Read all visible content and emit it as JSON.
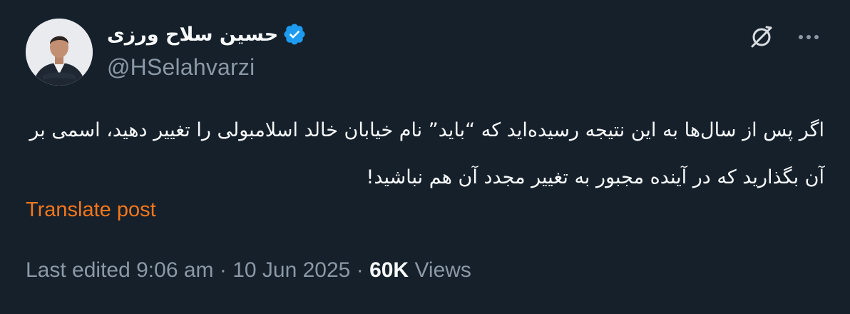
{
  "author": {
    "display_name": "حسین سلاح ورزی",
    "handle": "@HSelahvarzi",
    "verified": true
  },
  "icons": {
    "verified": "verified-badge-icon",
    "grok": "grok-icon",
    "more": "more-options-icon"
  },
  "tweet": {
    "text": "اگر پس از سال‌ها به این نتیجه رسیده‌اید که “باید” نام خیابان خالد اسلامبولی را تغییر دهید، اسمی بر آن بگذارید که در آینده مجبور به تغییر مجدد آن هم نباشید!",
    "translate_label": "Translate post"
  },
  "meta": {
    "edited_label": "Last edited",
    "time": "9:06 am",
    "separator": "·",
    "date": "10 Jun 2025",
    "views_count": "60K",
    "views_label": "Views"
  },
  "colors": {
    "background": "#15202b",
    "text_primary": "#f7f9f9",
    "text_secondary": "#8b98a5",
    "verified_blue": "#1d9bf0",
    "translate_link": "#f4761c"
  }
}
